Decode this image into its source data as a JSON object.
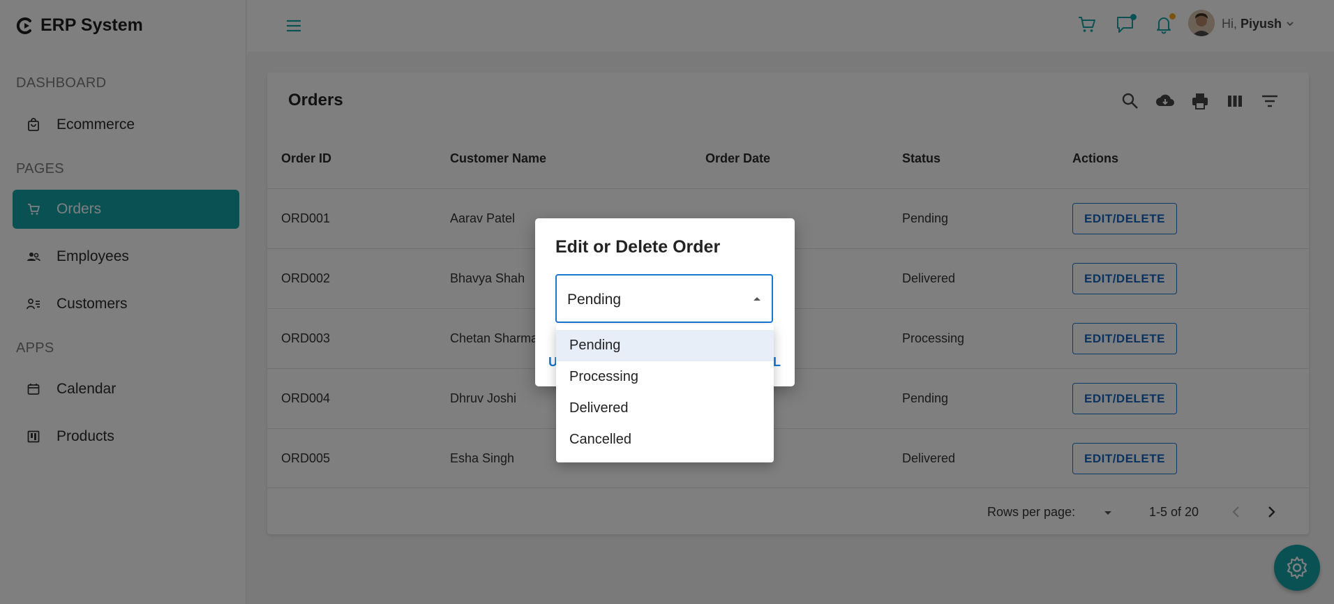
{
  "brand": {
    "title": "ERP System"
  },
  "sidebar": {
    "sections": [
      {
        "label": "DASHBOARD"
      },
      {
        "label": "PAGES"
      },
      {
        "label": "APPS"
      }
    ],
    "items": [
      {
        "label": "Ecommerce",
        "icon": "shopping-bag-icon"
      },
      {
        "label": "Orders",
        "icon": "cart-icon",
        "active": true
      },
      {
        "label": "Employees",
        "icon": "people-icon"
      },
      {
        "label": "Customers",
        "icon": "person-list-icon"
      },
      {
        "label": "Calendar",
        "icon": "calendar-icon"
      },
      {
        "label": "Products",
        "icon": "products-icon"
      }
    ]
  },
  "header": {
    "greeting_prefix": "Hi,",
    "user_name": "Piyush",
    "badges": {
      "messages_color": "#14a3a9",
      "notifications_color": "#f5a623"
    }
  },
  "orders": {
    "title": "Orders",
    "toolbar": [
      "search-icon",
      "download-icon",
      "print-icon",
      "columns-icon",
      "filter-icon"
    ],
    "columns": [
      "Order ID",
      "Customer Name",
      "Order Date",
      "Status",
      "Actions"
    ],
    "rows": [
      {
        "id": "ORD001",
        "customer": "Aarav Patel",
        "status": "Pending"
      },
      {
        "id": "ORD002",
        "customer": "Bhavya Shah",
        "status": "Delivered"
      },
      {
        "id": "ORD003",
        "customer": "Chetan Sharma",
        "status": "Processing"
      },
      {
        "id": "ORD004",
        "customer": "Dhruv Joshi",
        "status": "Pending"
      },
      {
        "id": "ORD005",
        "customer": "Esha Singh",
        "status": "Delivered"
      }
    ],
    "action_label": "EDIT/DELETE",
    "footer": {
      "rows_per_page_label": "Rows per page:",
      "range": "1-5 of 20"
    }
  },
  "dialog": {
    "title": "Edit or Delete Order",
    "selected": "Pending",
    "action_left": "U",
    "action_right": "L"
  },
  "status_menu": {
    "options": [
      "Pending",
      "Processing",
      "Delivered",
      "Cancelled"
    ],
    "highlighted": "Pending"
  },
  "colors": {
    "accent": "#14a3a9",
    "link": "#1976d2"
  }
}
